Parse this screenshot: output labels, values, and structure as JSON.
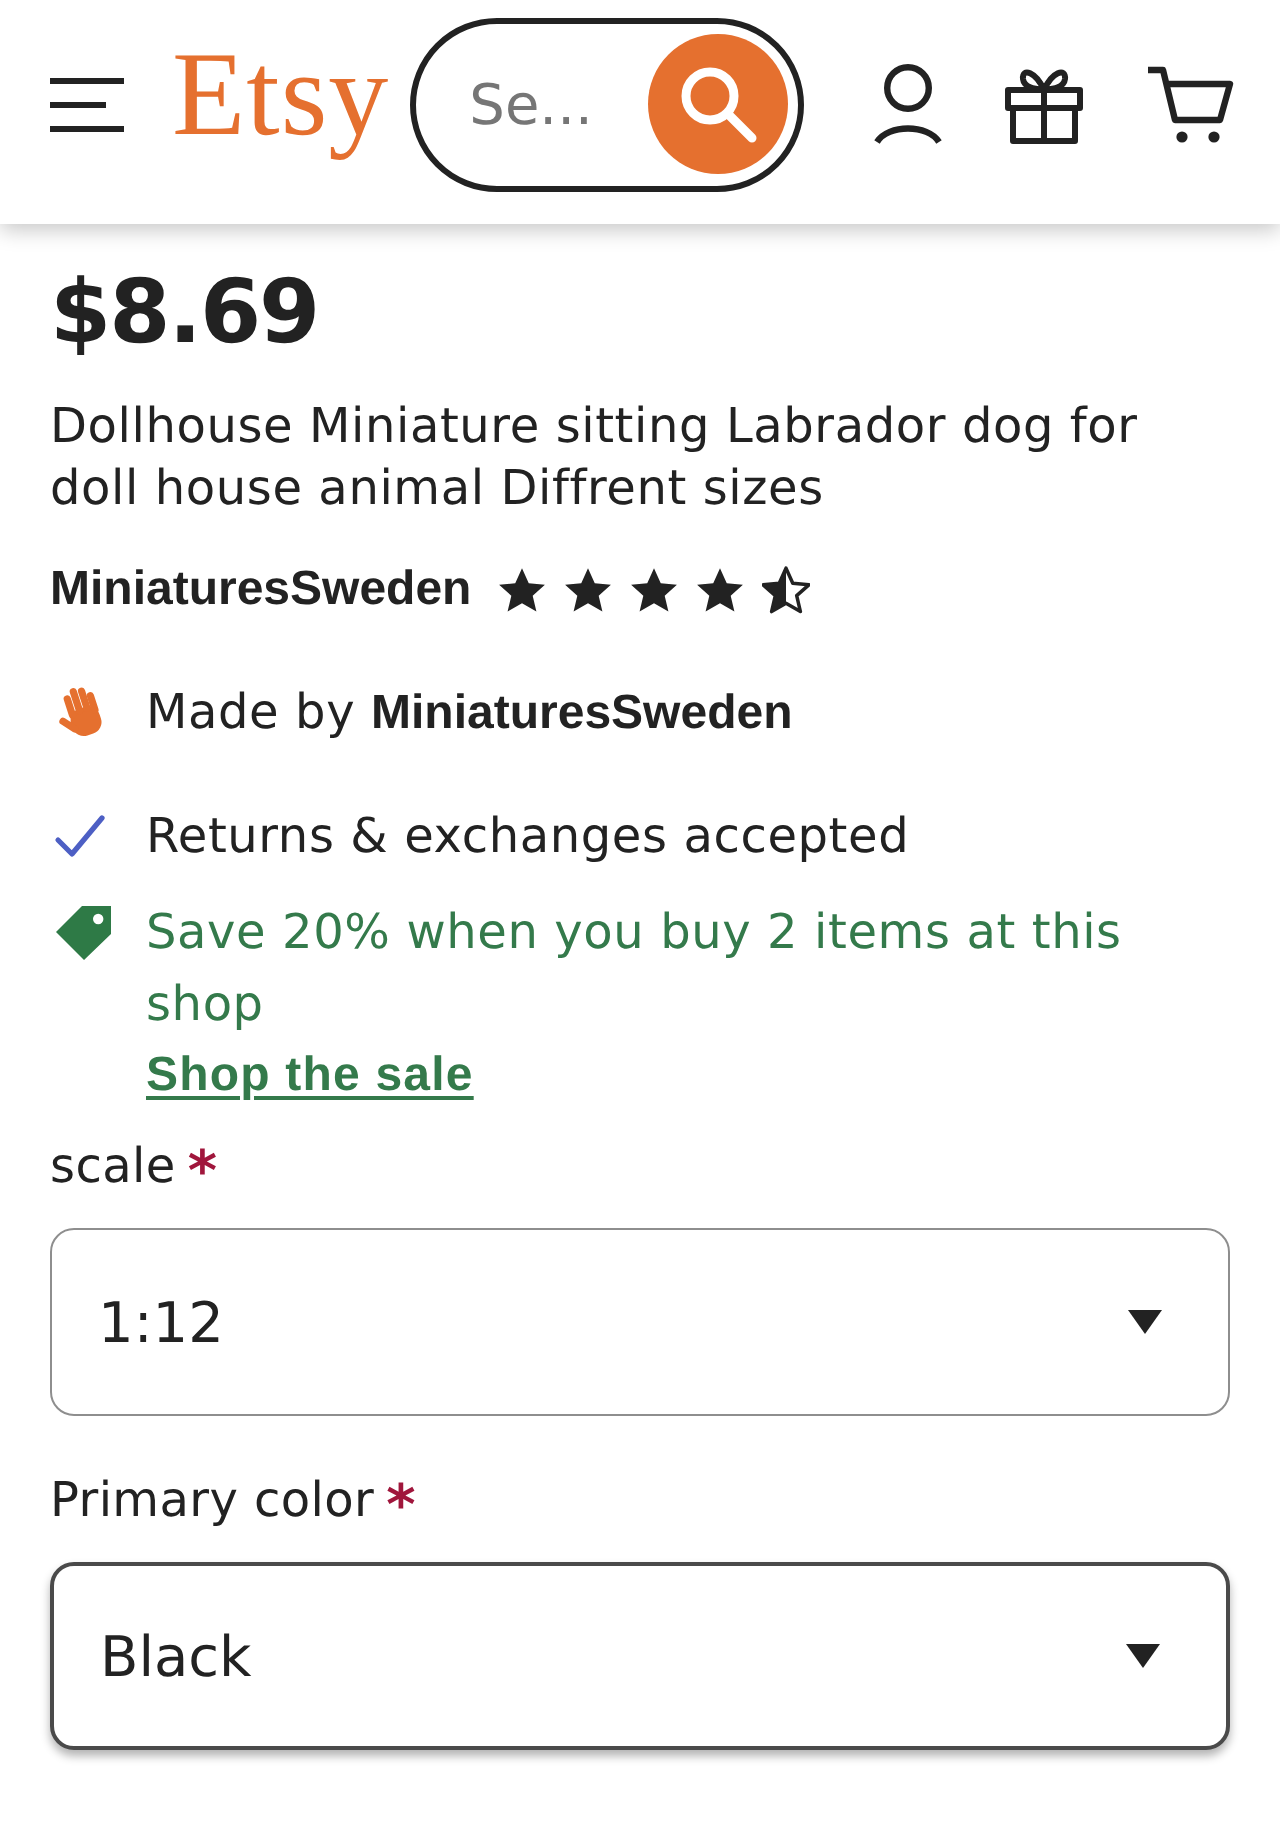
{
  "header": {
    "logo": "Etsy",
    "search": {
      "placeholder": "Se..."
    }
  },
  "product": {
    "price": "$8.69",
    "title": "Dollhouse Miniature sitting Labrador dog for doll house animal Diffrent sizes",
    "shop": "MiniaturesSweden",
    "stars": 4.5
  },
  "maker": {
    "text": "Made by **MiniaturesSweden**"
  },
  "perks": [
    {
      "kind": "returns",
      "text": "Returns & exchanges accepted"
    },
    {
      "kind": "sale",
      "text": "Save 20% when you buy 2 items at this shop",
      "link": "Shop the sale"
    }
  ],
  "options": [
    {
      "label": "scale",
      "required_mark": "*",
      "value": "1:12",
      "focused": false
    },
    {
      "label": "Primary color",
      "required_mark": "*",
      "value": "Black",
      "focused": true
    }
  ]
}
